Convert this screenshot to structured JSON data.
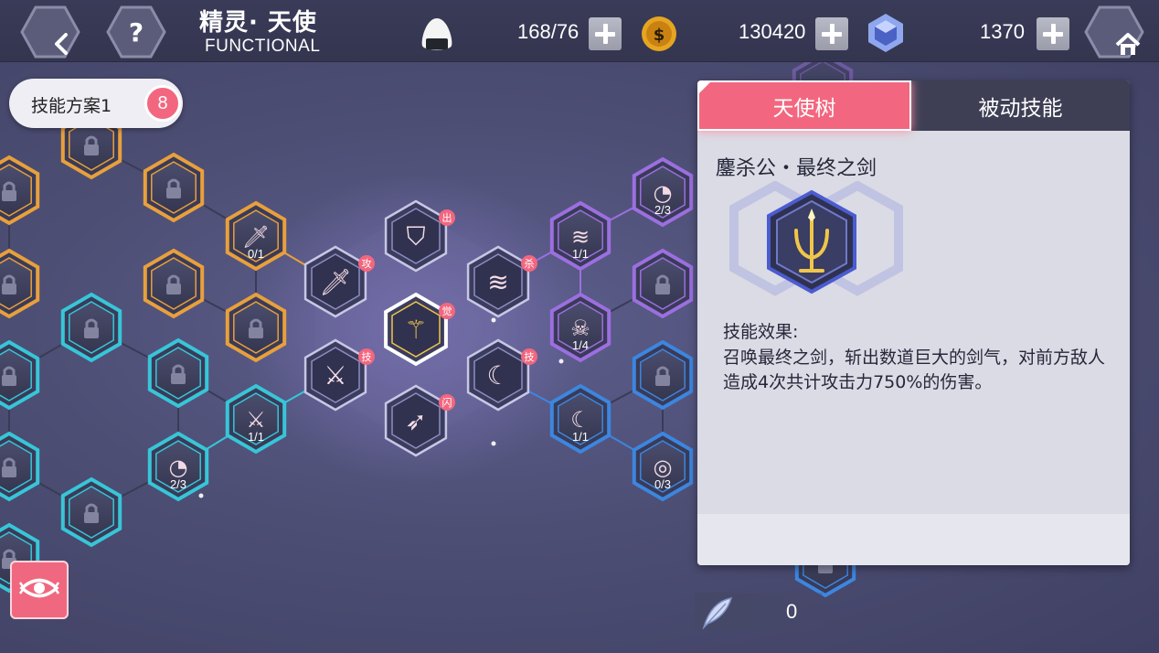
{
  "header": {
    "title_cn": "精灵· 天使",
    "title_en": "FUNCTIONAL",
    "back_icon": "back-icon",
    "help_icon": "help-icon",
    "home_icon": "home-icon"
  },
  "resources": {
    "stamina": {
      "icon": "rice-ball-icon",
      "value": "168/76"
    },
    "gold": {
      "icon": "gold-coin-icon",
      "value": "130420"
    },
    "crystal": {
      "icon": "crystal-gem-icon",
      "value": "1370"
    }
  },
  "plan": {
    "label": "技能方案1",
    "count": "8"
  },
  "tabs": [
    {
      "label": "天使树",
      "active": true
    },
    {
      "label": "被动技能",
      "active": false
    }
  ],
  "detail": {
    "skill_name": "鏖杀公・最终之剑",
    "effect_label": "技能效果:",
    "effect_text": "召唤最终之剑，斩出数道巨大的剑气，对前方敌人造成4次共计攻击力750%的伤害。"
  },
  "center_nodes": [
    {
      "name": "final-sword-node",
      "icon": "trident-sword-icon",
      "badge": "觉",
      "selected": true
    },
    {
      "name": "emblem-node",
      "icon": "emblem-icon",
      "badge": "出"
    },
    {
      "name": "sword-node",
      "icon": "sword-icon",
      "badge": "攻"
    },
    {
      "name": "slash-node",
      "icon": "triple-slash-icon",
      "badge": "杀"
    },
    {
      "name": "multi-sword-node",
      "icon": "multi-sword-icon",
      "badge": "技"
    },
    {
      "name": "crescent-node",
      "icon": "crescent-slash-icon",
      "badge": "技"
    },
    {
      "name": "dash-node",
      "icon": "dash-icon",
      "badge": "闪"
    }
  ],
  "node_labels": {
    "fx_sword": "0/1",
    "fx_swords": "1/1",
    "cyan_rank": "2/3",
    "slash_rank": "1/1",
    "skull_rank": "1/4",
    "fx_crescent": "1/1",
    "purple_rank": "2/3",
    "target_rank": "0/3"
  },
  "feather": {
    "icon": "feather-icon",
    "value": "0"
  },
  "eye_icon": "eye-icon",
  "colors": {
    "accent": "#f2677f",
    "orange": "#e8a03c",
    "cyan": "#37c6d8",
    "purple": "#9c6fe0",
    "blue": "#3c86e0"
  }
}
